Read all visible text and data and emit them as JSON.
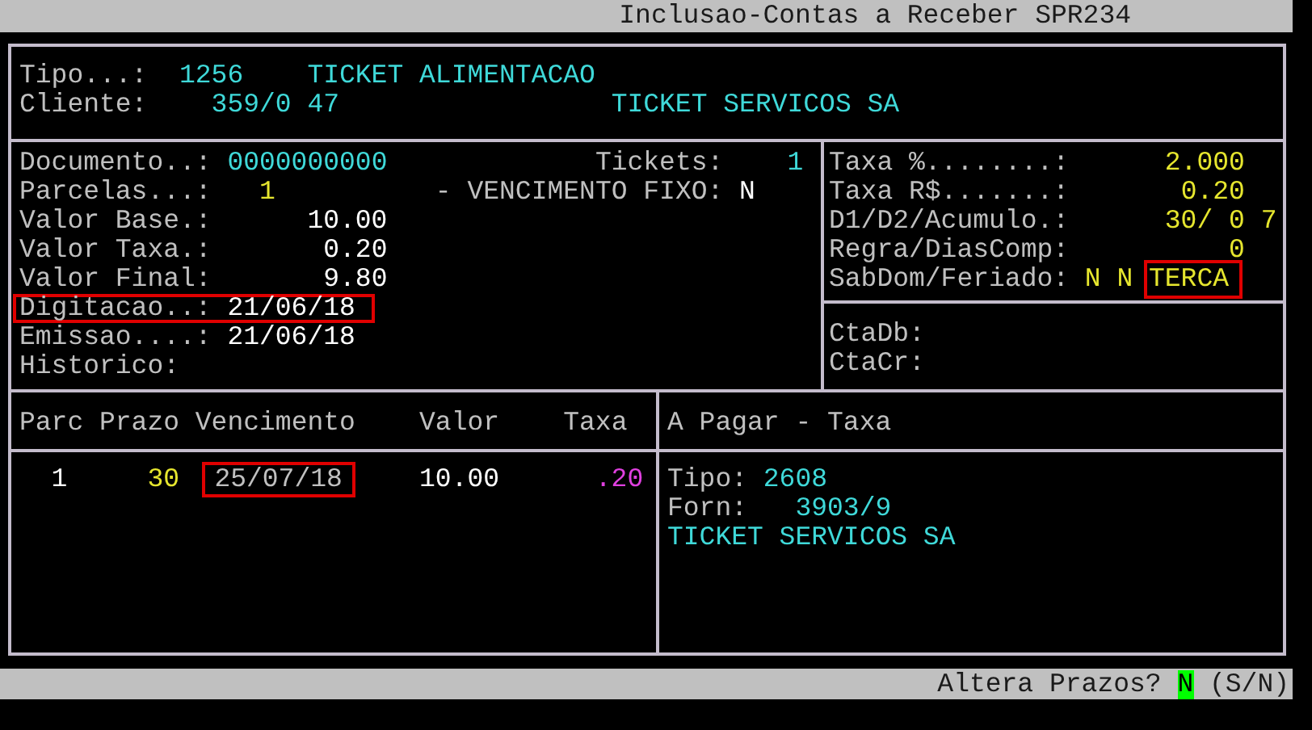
{
  "title_bar": {
    "title": "Inclusao-Contas a Receber SPR234"
  },
  "header": {
    "tipo": {
      "label": "Tipo...:",
      "code": "1256",
      "name": "TICKET ALIMENTACAO"
    },
    "cliente": {
      "label": "Cliente:",
      "code": "359/0 47",
      "name": "TICKET SERVICOS SA"
    }
  },
  "document": {
    "fields": [
      {
        "label": "Documento..:",
        "value": "0000000000",
        "kind": "text",
        "color": "#3fd9d9",
        "highlighted": false,
        "extra": {
          "label": "Tickets:",
          "value": "1",
          "kind": "count",
          "color": "#3fd9d9"
        }
      },
      {
        "label": "Parcelas...:",
        "value": "1",
        "kind": "count",
        "color": "#e6e62e",
        "highlighted": false,
        "extra": {
          "label": "- VENCIMENTO FIXO:",
          "value": "N",
          "kind": "flag",
          "color": "#ffffff"
        }
      },
      {
        "label": "Valor Base.:",
        "value": "10.00",
        "kind": "amount",
        "color": "#ffffff",
        "highlighted": false
      },
      {
        "label": "Valor Taxa.:",
        "value": "0.20",
        "kind": "amount",
        "color": "#ffffff",
        "highlighted": false
      },
      {
        "label": "Valor Final:",
        "value": "9.80",
        "kind": "amount",
        "color": "#ffffff",
        "highlighted": false
      },
      {
        "label": "Digitacao..:",
        "value": "21/06/18",
        "kind": "text",
        "highlighted": true
      },
      {
        "label": "Emissao....:",
        "value": "21/06/18",
        "kind": "text",
        "color": "#ffffff",
        "highlighted": false
      },
      {
        "label": "Historico:",
        "highlighted": false
      }
    ]
  },
  "rates": [
    {
      "label": "Taxa %........:",
      "kind": "amount",
      "values": [
        {
          "text": "2.000",
          "color": "#e6e62e",
          "highlighted": false
        }
      ]
    },
    {
      "label": "Taxa R$.......:",
      "kind": "amount",
      "values": [
        {
          "text": "0.20",
          "color": "#e6e62e",
          "highlighted": false
        }
      ]
    },
    {
      "label": "D1/D2/Acumulo.:",
      "kind": "amount",
      "values": [
        {
          "text": "30/ 0",
          "color": "#e6e62e",
          "highlighted": false
        },
        {
          "text": "7",
          "color": "#e6e62e",
          "highlighted": false
        }
      ]
    },
    {
      "label": "Regra/DiasComp:",
      "kind": "amount",
      "values": [
        {
          "text": "0",
          "color": "#e6e62e",
          "highlighted": false
        }
      ]
    },
    {
      "label": "SabDom/Feriado:",
      "kind": "flags",
      "values": [
        {
          "text": "N",
          "color": "#e6e62e",
          "highlighted": false
        },
        {
          "text": "N",
          "color": "#e6e62e",
          "highlighted": false
        },
        {
          "text": "TERCA",
          "color": "#e6e62e",
          "highlighted": true
        }
      ]
    }
  ],
  "accounts": [
    {
      "label": "CtaDb:"
    },
    {
      "label": "CtaCr:"
    }
  ],
  "installments": {
    "columns": [
      "Parc",
      "Prazo",
      "Vencimento",
      "Valor",
      "Taxa"
    ],
    "rows": [
      {
        "parc": "1",
        "prazo": "30",
        "vencimento": "25/07/18",
        "vencimento_highlighted": true,
        "valor": "10.00",
        "taxa": ".20"
      }
    ]
  },
  "payable": {
    "title": "A Pagar - Taxa",
    "tipo": {
      "label": "Tipo:",
      "value": "2608"
    },
    "forn": {
      "label": "Forn:",
      "value": "3903/9"
    },
    "name": "TICKET SERVICOS SA"
  },
  "status_bar": {
    "prompt": "Altera Prazos?",
    "answer": "N",
    "options": "(S/N)"
  }
}
